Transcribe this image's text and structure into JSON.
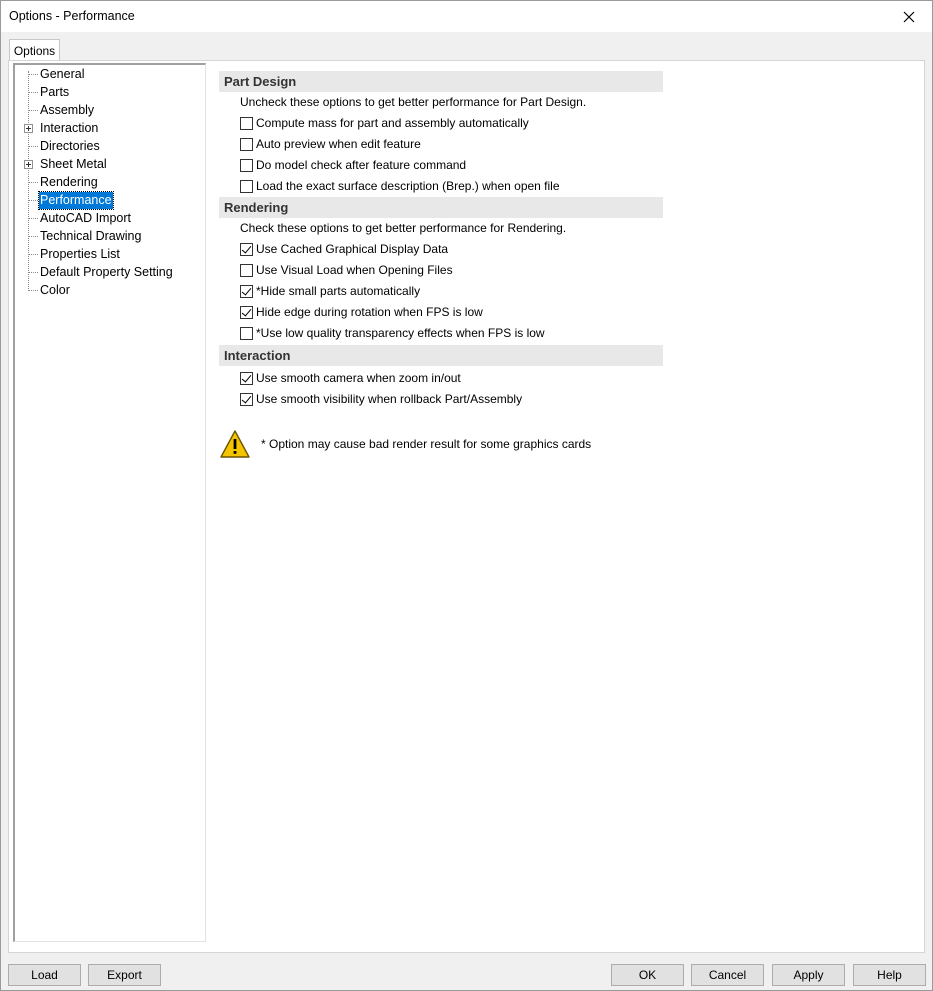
{
  "window": {
    "title": "Options - Performance"
  },
  "tab": {
    "label": "Options"
  },
  "tree": {
    "items": [
      {
        "label": "General",
        "expandable": false,
        "selected": false
      },
      {
        "label": "Parts",
        "expandable": false,
        "selected": false
      },
      {
        "label": "Assembly",
        "expandable": false,
        "selected": false
      },
      {
        "label": "Interaction",
        "expandable": true,
        "selected": false
      },
      {
        "label": "Directories",
        "expandable": false,
        "selected": false
      },
      {
        "label": "Sheet Metal",
        "expandable": true,
        "selected": false
      },
      {
        "label": "Rendering",
        "expandable": false,
        "selected": false
      },
      {
        "label": "Performance",
        "expandable": false,
        "selected": true
      },
      {
        "label": "AutoCAD Import",
        "expandable": false,
        "selected": false
      },
      {
        "label": "Technical Drawing",
        "expandable": false,
        "selected": false
      },
      {
        "label": "Properties List",
        "expandable": false,
        "selected": false
      },
      {
        "label": "Default Property Setting",
        "expandable": false,
        "selected": false
      },
      {
        "label": "Color",
        "expandable": false,
        "selected": false
      }
    ]
  },
  "sections": {
    "part_design": {
      "title": "Part Design",
      "description": "Uncheck these options to get better performance for Part Design.",
      "options": [
        {
          "label": "Compute mass for part and assembly automatically",
          "checked": false
        },
        {
          "label": "Auto preview when edit feature",
          "checked": false
        },
        {
          "label": "Do model check after feature command",
          "checked": false
        },
        {
          "label": "Load the exact surface description (Brep.) when open file",
          "checked": false
        }
      ]
    },
    "rendering": {
      "title": "Rendering",
      "description": "Check these options to get better performance for Rendering.",
      "options": [
        {
          "label": "Use Cached Graphical Display Data",
          "checked": true
        },
        {
          "label": "Use Visual Load when Opening Files",
          "checked": false
        },
        {
          "label": "*Hide small parts automatically",
          "checked": true
        },
        {
          "label": "Hide edge during rotation when FPS is low",
          "checked": true
        },
        {
          "label": "*Use low quality transparency effects when FPS is low",
          "checked": false
        }
      ]
    },
    "interaction": {
      "title": "Interaction",
      "options": [
        {
          "label": "Use smooth camera when zoom in/out",
          "checked": true
        },
        {
          "label": "Use smooth visibility when rollback Part/Assembly",
          "checked": true
        }
      ]
    }
  },
  "warning": {
    "icon": "warning-triangle-icon",
    "text": "* Option may cause bad render result for some graphics cards"
  },
  "buttons": {
    "load": "Load",
    "export": "Export",
    "ok": "OK",
    "cancel": "Cancel",
    "apply": "Apply",
    "help": "Help"
  }
}
